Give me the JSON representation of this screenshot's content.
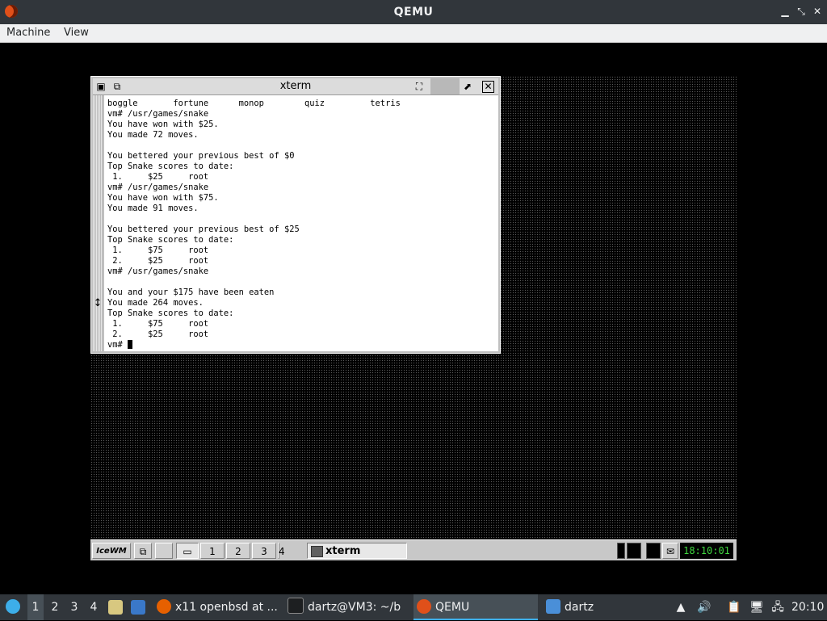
{
  "host": {
    "title": "QEMU",
    "menus": [
      "Machine",
      "View"
    ]
  },
  "xterm": {
    "title": "xterm",
    "lines": [
      "boggle       fortune      monop        quiz         tetris",
      "vm# /usr/games/snake",
      "You have won with $25.",
      "You made 72 moves.",
      "",
      "You bettered your previous best of $0",
      "Top Snake scores to date:",
      " 1.     $25     root",
      "vm# /usr/games/snake",
      "You have won with $75.",
      "You made 91 moves.",
      "",
      "You bettered your previous best of $25",
      "Top Snake scores to date:",
      " 1.     $75     root",
      " 2.     $25     root",
      "vm# /usr/games/snake",
      "",
      "You and your $175 have been eaten",
      "You made 264 moves.",
      "Top Snake scores to date:",
      " 1.     $75     root",
      " 2.     $25     root"
    ],
    "prompt": "vm# "
  },
  "guest_panel": {
    "logo": "IceWM",
    "workspaces": [
      "1",
      "2",
      "3",
      "4"
    ],
    "task_label": "xterm",
    "clock": "18:10:01"
  },
  "host_taskbar": {
    "workspaces": [
      "1",
      "2",
      "3",
      "4"
    ],
    "tasks": [
      {
        "label": "x11 openbsd at ...",
        "icon": "firefox-icon"
      },
      {
        "label": "dartz@VM3: ~/b",
        "icon": "terminal-icon"
      },
      {
        "label": "QEMU",
        "icon": "qemu-icon"
      },
      {
        "label": "dartz",
        "icon": "folder-icon"
      }
    ],
    "clock": "20:10"
  },
  "colors": {
    "host_chrome": "#31363b",
    "clock_green": "#3fd63f",
    "accent": "#3daee9"
  }
}
